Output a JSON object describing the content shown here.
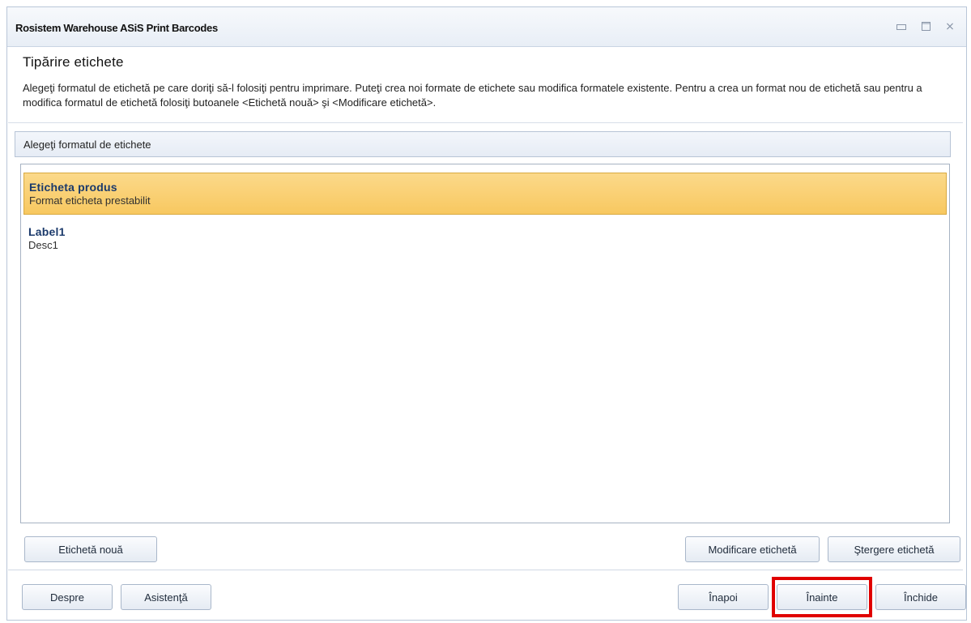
{
  "window": {
    "title": "Rosistem Warehouse ASiS Print Barcodes",
    "controls": {
      "minimize": "",
      "maximize": "",
      "close": "⨯"
    }
  },
  "page": {
    "heading": "Tipărire etichete",
    "description": "Alegeţi formatul de etichetă pe care doriţi să-l folosiţi pentru imprimare. Puteţi crea noi formate de etichete sau modifica formatele existente. Pentru a crea un format nou de etichetă sau pentru a modifica formatul de etichetă folosiţi butoanele <Etichetă nouă> şi <Modificare etichetă>."
  },
  "group": {
    "header": "Alegeţi formatul de etichete"
  },
  "labels": [
    {
      "title": "Eticheta produs",
      "desc": "Format eticheta prestabilit",
      "selected": true
    },
    {
      "title": "Label1",
      "desc": "Desc1",
      "selected": false
    }
  ],
  "actions": {
    "new_label": "Etichetă nouă",
    "modify_label": "Modificare etichetă",
    "delete_label": "Ştergere etichetă"
  },
  "footer": {
    "about": "Despre",
    "help": "Asistenţă",
    "back": "Înapoi",
    "next": "Înainte",
    "close": "Închide"
  },
  "colors": {
    "selected_item": "#f8c860",
    "highlight_box": "#e00000",
    "item_title": "#1b3a6b"
  }
}
